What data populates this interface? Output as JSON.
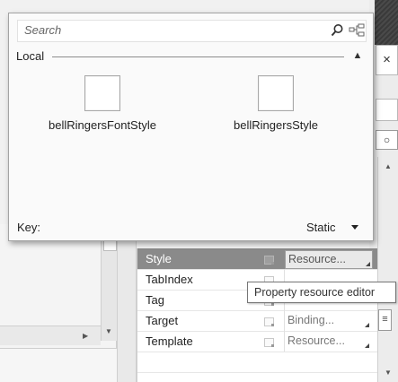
{
  "popup": {
    "search": {
      "placeholder": "Search",
      "value": ""
    },
    "section_label": "Local",
    "resources": [
      {
        "name": "bellRingersFontStyle"
      },
      {
        "name": "bellRingersStyle"
      }
    ],
    "key_label": "Key:",
    "scope_select": {
      "selected": "Static"
    }
  },
  "properties": {
    "rows": [
      {
        "name": "Style",
        "value": "Resource...",
        "selected": true
      },
      {
        "name": "TabIndex",
        "value": ""
      },
      {
        "name": "Tag",
        "value": ""
      },
      {
        "name": "Target",
        "value": "Binding..."
      },
      {
        "name": "Template",
        "value": "Resource..."
      }
    ]
  },
  "tooltip": {
    "text": "Property resource editor"
  },
  "side": {
    "close_glyph": "×",
    "toggle_glyph": "○"
  },
  "colors": {
    "selected_row": "#8a8a8a",
    "popup_bg": "#fafafa"
  }
}
